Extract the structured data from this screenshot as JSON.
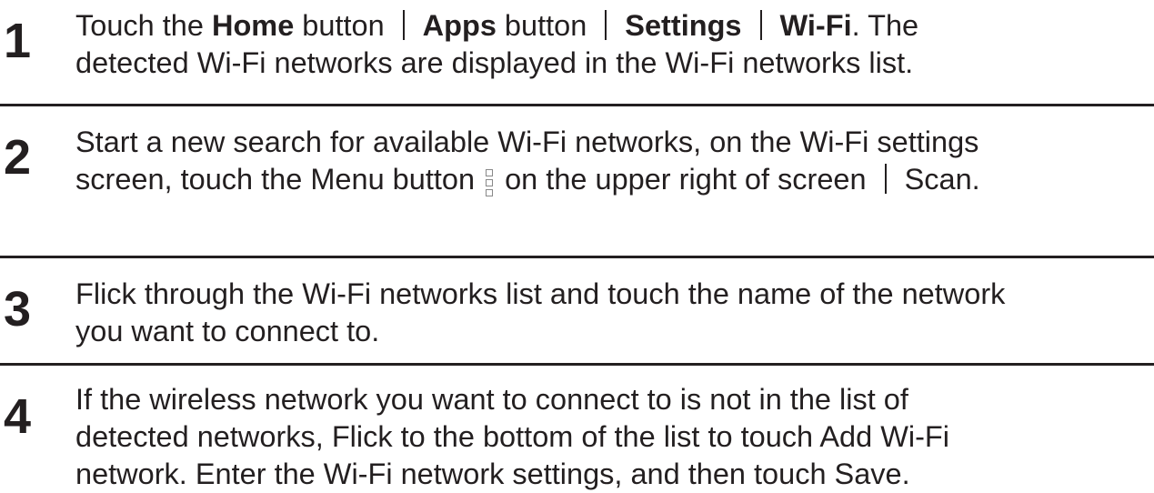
{
  "steps": [
    {
      "number": "1",
      "line1": {
        "pre": "Touch the ",
        "home": "Home",
        "button1": " button",
        "apps": "Apps",
        "button2": " button",
        "settings": "Settings",
        "wifi": "Wi-Fi",
        "post": ". The"
      },
      "line2": "detected Wi-Fi networks are displayed in the Wi-Fi networks list."
    },
    {
      "number": "2",
      "line1": "Start a new search for available Wi-Fi networks, on the Wi-Fi settings",
      "line2_pre": "screen, touch the Menu button ",
      "line2_mid": " on the upper right of screen",
      "line2_post": "Scan."
    },
    {
      "number": "3",
      "line1": "Flick through the Wi-Fi networks list and touch the name of the network",
      "line2": "you want to connect to."
    },
    {
      "number": "4",
      "line1": "If the wireless network you want to connect to is not in the list of",
      "line2": "detected networks, Flick to the bottom of the list to touch Add Wi-Fi",
      "line3": "network. Enter the Wi-Fi network settings, and then touch Save."
    }
  ],
  "icons": {
    "menu_icon": "menu-icon"
  }
}
